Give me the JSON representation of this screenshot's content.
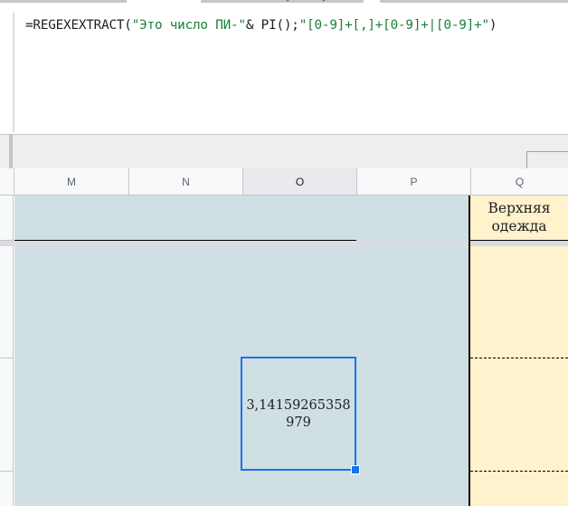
{
  "formula_bar": {
    "formula_prefix": "=REGEXEXTRACT(",
    "string_1": "\"Это число ПИ-\"",
    "middle": "& PI();",
    "string_2": "\"[0-9]+[,]+[0-9]+|[0-9]+\"",
    "suffix": ")"
  },
  "columns": [
    "M",
    "N",
    "O",
    "P",
    "Q"
  ],
  "active_column": "O",
  "cells": {
    "q_header": "Верхняя одежда",
    "active_value": "3,14159265358979"
  },
  "colors": {
    "formula_string": "#188038",
    "selection": "#1a73e8",
    "blue_fill": "#d0dfe3",
    "yellow_fill": "#fff2cc"
  }
}
